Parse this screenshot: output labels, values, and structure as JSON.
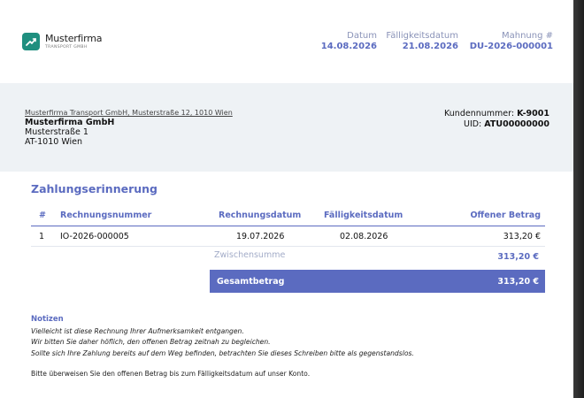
{
  "company": {
    "name": "Musterfirma",
    "tagline": "TRANSPORT GMBH",
    "logo_icon": "trend-line-icon",
    "brand_color": "#1f8f7f"
  },
  "meta": {
    "date_label": "Datum",
    "date_value": "14.08.2026",
    "due_label": "Fälligkeitsdatum",
    "due_value": "21.08.2026",
    "reminder_label": "Mahnung #",
    "reminder_value": "DU-2026-000001"
  },
  "sender_line": "Musterfirma Transport GmbH, Musterstraße 12, 1010 Wien",
  "recipient": {
    "name": "Musterfirma GmbH",
    "street": "Musterstraße 1",
    "city": "AT-1010 Wien"
  },
  "customer": {
    "number_label": "Kundennummer:",
    "number_value": "K-9001",
    "uid_label": "UID:",
    "uid_value": "ATU00000000"
  },
  "title": "Zahlungserinnerung",
  "table": {
    "headers": [
      "#",
      "Rechnungsnummer",
      "Rechnungsdatum",
      "Fälligkeitsdatum",
      "Offener Betrag"
    ],
    "rows": [
      [
        "1",
        "IO-2026-000005",
        "19.07.2026",
        "02.08.2026",
        "313,20 €"
      ]
    ]
  },
  "subtotal": {
    "label": "Zwischensumme",
    "value": "313,20 €"
  },
  "total": {
    "label": "Gesamtbetrag",
    "value": "313,20 €"
  },
  "notes": {
    "heading": "Notizen",
    "lines": [
      "Vielleicht ist diese Rechnung Ihrer Aufmerksamkeit entgangen.",
      "Wir bitten Sie daher höflich, den offenen Betrag zeitnah zu begleichen.",
      "Sollte sich Ihre Zahlung bereits auf dem Weg befinden, betrachten Sie dieses Schreiben bitte als gegenstandslos."
    ]
  },
  "footer": "Bitte überweisen Sie den offenen Betrag bis zum Fälligkeitsdatum auf unser Konto.",
  "accent_color": "#5b6bc0"
}
